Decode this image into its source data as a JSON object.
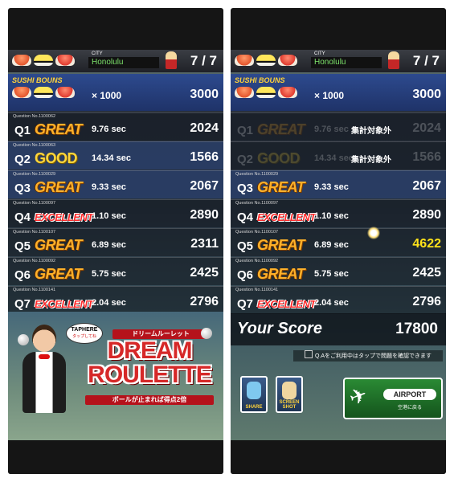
{
  "left": {
    "city_label": "CITY",
    "city": "Honolulu",
    "progress": "7 / 7",
    "bonus_label": "SUSHI BOUNS",
    "bonus_mult": "× 1000",
    "bonus_value": "3000",
    "rows": [
      {
        "qno": "Question No.1100062",
        "q": "Q1",
        "rank": "GREAT",
        "time": "9.76 sec",
        "pts": "2024"
      },
      {
        "qno": "Question No.1100063",
        "q": "Q2",
        "rank": "GOOD",
        "time": "14.34 sec",
        "pts": "1566"
      },
      {
        "qno": "Question No.1100029",
        "q": "Q3",
        "rank": "GREAT",
        "time": "9.33 sec",
        "pts": "2067"
      },
      {
        "qno": "Question No.1100097",
        "q": "Q4",
        "rank": "EXCELLENT",
        "time": "1.10 sec",
        "pts": "2890"
      },
      {
        "qno": "Question No.1100107",
        "q": "Q5",
        "rank": "GREAT",
        "time": "6.89 sec",
        "pts": "2311"
      },
      {
        "qno": "Question No.1100092",
        "q": "Q6",
        "rank": "GREAT",
        "time": "5.75 sec",
        "pts": "2425"
      },
      {
        "qno": "Question No.1100141",
        "q": "Q7",
        "rank": "EXCELLENT",
        "time": "2.04 sec",
        "pts": "2796"
      }
    ],
    "banner": {
      "tap_here": "TAPHERE",
      "tap_sub": "タップしてね",
      "subtitle": "ドリームルーレット",
      "title": "DREAM ROULETTE",
      "footer": "ボールが止まれば得点2倍"
    }
  },
  "right": {
    "city_label": "CITY",
    "city": "Honolulu",
    "progress": "7 / 7",
    "bonus_label": "SUSHI BOUNS",
    "bonus_mult": "× 1000",
    "bonus_value": "3000",
    "rows": [
      {
        "qno": "",
        "q": "Q1",
        "rank": "GREAT",
        "time": "9.76 sec",
        "note": "集計対象外",
        "pts": "2024"
      },
      {
        "qno": "",
        "q": "Q2",
        "rank": "GOOD",
        "time": "14.34 sec",
        "note": "集計対象外",
        "pts": "1566"
      },
      {
        "qno": "Question No.1100029",
        "q": "Q3",
        "rank": "GREAT",
        "time": "9.33 sec",
        "pts": "2067"
      },
      {
        "qno": "Question No.1100097",
        "q": "Q4",
        "rank": "EXCELLENT",
        "time": "1.10 sec",
        "pts": "2890"
      },
      {
        "qno": "Question No.1100107",
        "q": "Q5",
        "rank": "GREAT",
        "time": "6.89 sec",
        "pts": "4622"
      },
      {
        "qno": "Question No.1100092",
        "q": "Q6",
        "rank": "GREAT",
        "time": "5.75 sec",
        "pts": "2425"
      },
      {
        "qno": "Question No.1100141",
        "q": "Q7",
        "rank": "EXCELLENT",
        "time": "2.04 sec",
        "pts": "2796"
      }
    ],
    "your_score_label": "Your Score",
    "your_score": "17800",
    "hint": "Q.Aをご利用中はタップで問題を確認できます",
    "share_label": "SHARE",
    "screenshot_label": "SCREEN SHOT",
    "airport_label": "AIRPORT",
    "airport_sub": "空港に戻る"
  },
  "colors": {
    "great": "#ffb12a",
    "good": "#ffd63a",
    "excellent": "#ff2b2b",
    "highlight_score": "#ffe21a",
    "city_text": "#7de36b"
  }
}
